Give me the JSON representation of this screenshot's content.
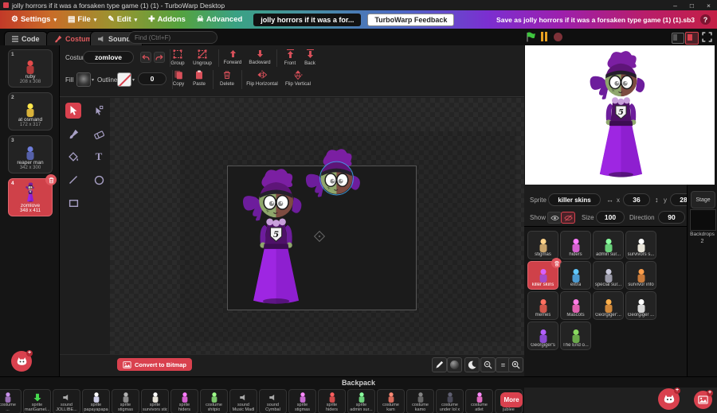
{
  "titlebar": {
    "title": "jolly horrors if it was a forsaken type game (1) (1) - TurboWarp Desktop",
    "minimize": "–",
    "maximize": "□",
    "close": "×"
  },
  "menubar": {
    "caret": "▾",
    "settings": "Settings",
    "file": "File",
    "edit": "Edit",
    "addons": "Addons",
    "advanced": "Advanced",
    "project_name": "jolly horrors if it was a for...",
    "feedback": "TurboWarp Feedback",
    "save": "Save as jolly horrors if it was a forsaken type game (1) (1).sb3",
    "help": "?"
  },
  "tabs": {
    "code": "Code",
    "costumes": "Costumes",
    "sounds": "Sounds",
    "find_placeholder": "Find (Ctrl+F)"
  },
  "paint": {
    "costume_label": "Costume",
    "costume_name": "zomlove",
    "group": "Group",
    "ungroup": "Ungroup",
    "forward": "Forward",
    "backward": "Backward",
    "front": "Front",
    "back": "Back",
    "fill_label": "Fill",
    "outline_label": "Outline",
    "stroke_width": "0",
    "copy": "Copy",
    "paste": "Paste",
    "delete": "Delete",
    "flip_h": "Flip Horizontal",
    "flip_v": "Flip Vertical",
    "convert": "Convert to Bitmap",
    "zoom_equals": "="
  },
  "artwork": {
    "badge_text": "5"
  },
  "costumes": [
    {
      "index": "1",
      "name": "ruby",
      "size": "208 x 308",
      "color": "#b03a3a"
    },
    {
      "index": "2",
      "name": "at osmand",
      "size": "172 x 317",
      "color": "#d9b23a"
    },
    {
      "index": "3",
      "name": "reaper man",
      "size": "342 x 300",
      "color": "#5560a8"
    },
    {
      "index": "4",
      "name": "zomlove",
      "size": "348 x 411",
      "color": "#9c27b0",
      "selected": true
    }
  ],
  "sprite_pane": {
    "sprite_label": "Sprite",
    "sprite_name": "killer skins",
    "x_label": "x",
    "x_value": "36",
    "y_label": "y",
    "y_value": "28",
    "show_label": "Show",
    "size_label": "Size",
    "size_value": "100",
    "direction_label": "Direction",
    "direction_value": "90"
  },
  "sprites": [
    {
      "name": "stigmas",
      "color": "#c8a36a"
    },
    {
      "name": "hiders",
      "color": "#d55fd0"
    },
    {
      "name": "admin sur...",
      "color": "#6ad17a"
    },
    {
      "name": "survivors s...",
      "color": "#e8e4d8"
    },
    {
      "name": "killer skins",
      "color": "#a64ac9",
      "selected": true
    },
    {
      "name": "extra",
      "color": "#4a9ad1"
    },
    {
      "name": "special sur...",
      "color": "#9a9aa8"
    },
    {
      "name": "survivor info",
      "color": "#c87a3a"
    },
    {
      "name": "memes",
      "color": "#d1564a"
    },
    {
      "name": "Mascots",
      "color": "#e060b0"
    },
    {
      "name": "Georgiger'...",
      "color": "#d1883a"
    },
    {
      "name": "Georgiger ...",
      "color": "#d8d8d8"
    },
    {
      "name": "Georgiger's",
      "color": "#8a4ad1"
    },
    {
      "name": "The End o...",
      "color": "#6aa84a"
    }
  ],
  "stage_pane": {
    "stage_label": "Stage",
    "backdrops_label": "Backdrops",
    "backdrops_count": "2"
  },
  "backpack": {
    "title": "Backpack",
    "more": "More",
    "items": [
      {
        "type": "costume",
        "name": "...",
        "thumb": "figure",
        "color": "#9a6fb5"
      },
      {
        "type": "sprite",
        "name": "mariGamel...",
        "thumb": "arrow",
        "color": "#46d94e"
      },
      {
        "type": "sound",
        "name": "JOLLIBE...",
        "thumb": "speaker",
        "color": "#aaaaaa"
      },
      {
        "type": "sprite",
        "name": "papayapapa",
        "thumb": "figure",
        "color": "#cfcfe8"
      },
      {
        "type": "sprite",
        "name": "stigmas",
        "thumb": "figure",
        "color": "#8a8a8a"
      },
      {
        "type": "sprite",
        "name": "survivors stic",
        "thumb": "figure",
        "color": "#e8e4d8"
      },
      {
        "type": "sprite",
        "name": "hiders",
        "thumb": "figure",
        "color": "#d55fd0"
      },
      {
        "type": "costume",
        "name": "shitpio",
        "thumb": "figure",
        "color": "#7ac76a"
      },
      {
        "type": "sound",
        "name": "Music Madl",
        "thumb": "speaker",
        "color": "#aaaaaa"
      },
      {
        "type": "sound",
        "name": "Cymbal",
        "thumb": "speaker",
        "color": "#aaaaaa"
      },
      {
        "type": "sprite",
        "name": "stigmas",
        "thumb": "figure",
        "color": "#c76ad1"
      },
      {
        "type": "sprite",
        "name": "hiders",
        "thumb": "figure",
        "color": "#d14a4a"
      },
      {
        "type": "sprite",
        "name": "admin sur...",
        "thumb": "figure",
        "color": "#6ad17a"
      },
      {
        "type": "costume",
        "name": "kam",
        "thumb": "figure",
        "color": "#d86a5a"
      },
      {
        "type": "costume",
        "name": "kamo",
        "thumb": "figure",
        "color": "#666666"
      },
      {
        "type": "costume",
        "name": "under lol x",
        "thumb": "figure",
        "color": "#4a4a58"
      },
      {
        "type": "costume",
        "name": "atlet",
        "thumb": "figure",
        "color": "#e06ac0"
      },
      {
        "type": "costume",
        "name": "jublee",
        "thumb": "figure",
        "color": "#6a8ad1"
      }
    ]
  }
}
